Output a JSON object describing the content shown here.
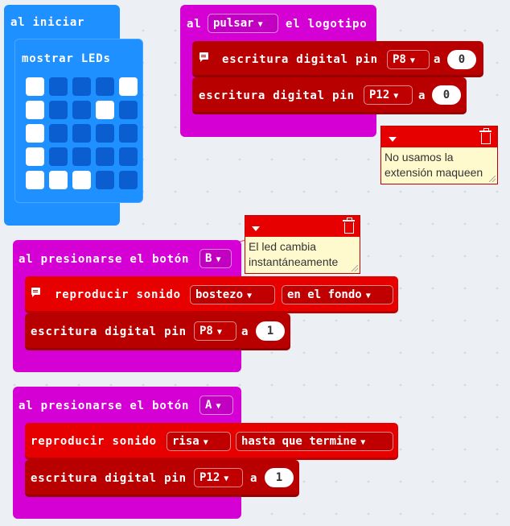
{
  "on_start": {
    "hat_label": "al iniciar",
    "show_leds_label": "mostrar LEDs",
    "leds": [
      [
        1,
        0,
        0,
        0,
        1
      ],
      [
        1,
        0,
        0,
        1,
        0
      ],
      [
        1,
        0,
        0,
        0,
        0
      ],
      [
        1,
        0,
        0,
        0,
        0
      ],
      [
        1,
        1,
        1,
        0,
        0
      ]
    ]
  },
  "on_logo": {
    "label_al": "al",
    "event_dropdown": "pulsar",
    "label_logo": "el logotipo",
    "blocks": [
      {
        "label": "escritura digital pin",
        "pin": "P8",
        "a": "a",
        "value": "0"
      },
      {
        "label": "escritura digital pin",
        "pin": "P12",
        "a": "a",
        "value": "0"
      }
    ],
    "comment": "No usamos la extensión maqueen"
  },
  "on_button_b": {
    "label": "al presionarse el botón",
    "button": "B",
    "sound_label": "reproducir sonido",
    "sound": "bostezo",
    "mode": "en el fondo",
    "write_label": "escritura digital pin",
    "pin": "P8",
    "a": "a",
    "value": "1",
    "comment": "El led cambia instantáneamente"
  },
  "on_button_a": {
    "label": "al presionarse el botón",
    "button": "A",
    "sound_label": "reproducir sonido",
    "sound": "risa",
    "mode": "hasta que termine",
    "write_label": "escritura digital pin",
    "pin": "P12",
    "a": "a",
    "value": "1"
  },
  "colors": {
    "basic": "#1e90ff",
    "input": "#d400d4",
    "pins": "#b80000",
    "music": "#e60000",
    "comment_bg": "#fffacd"
  }
}
